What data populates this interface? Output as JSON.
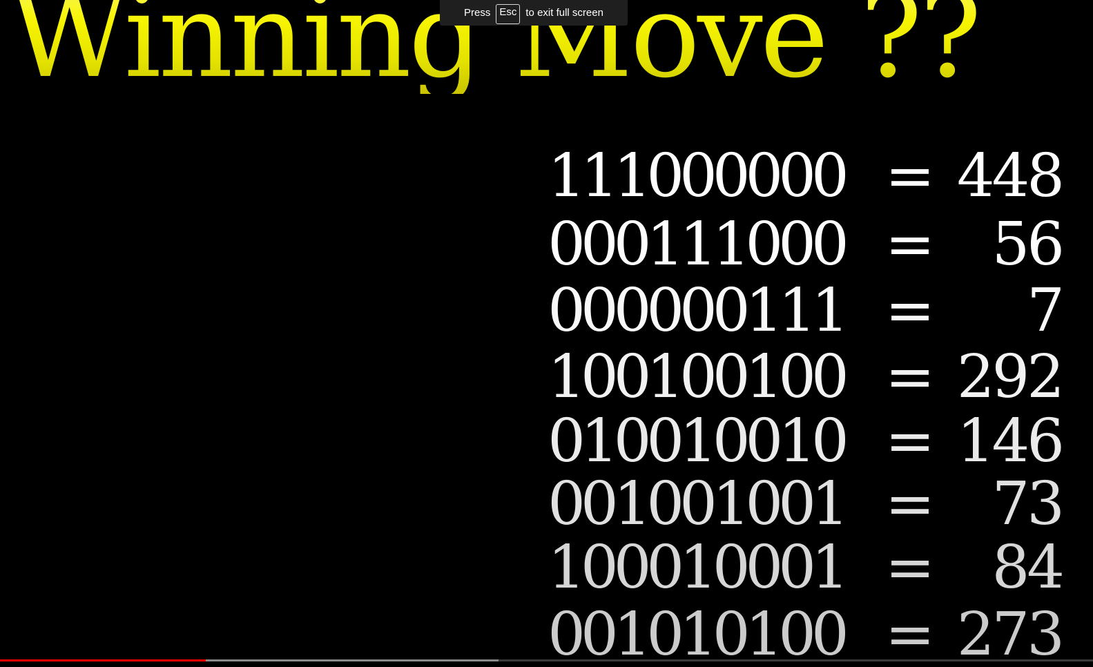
{
  "video": {
    "title": "Winning Move ??",
    "title_color": "#f6f400",
    "rows": [
      {
        "binary": "111000000",
        "equals": "=",
        "decimal": "448",
        "color": "#ffffff"
      },
      {
        "binary": "000111000",
        "equals": "=",
        "decimal": "56",
        "color": "#fdfdfd"
      },
      {
        "binary": "000000111",
        "equals": "=",
        "decimal": "7",
        "color": "#f8f8f8"
      },
      {
        "binary": "100100100",
        "equals": "=",
        "decimal": "292",
        "color": "#f2f2f2"
      },
      {
        "binary": "010010010",
        "equals": "=",
        "decimal": "146",
        "color": "#eaeaea"
      },
      {
        "binary": "001001001",
        "equals": "=",
        "decimal": "73",
        "color": "#e0e0e0"
      },
      {
        "binary": "100010001",
        "equals": "=",
        "decimal": "84",
        "color": "#d6d6d6"
      },
      {
        "binary": "001010100",
        "equals": "=",
        "decimal": "273",
        "color": "#cbcbcb"
      }
    ]
  },
  "fullscreen_toast": {
    "before": "Press",
    "key": "Esc",
    "after": "to exit full screen"
  },
  "player": {
    "played_fraction": 0.188,
    "buffered_fraction": 0.456,
    "played_color": "#ff0000",
    "buffered_color": "#8a8a8a"
  }
}
